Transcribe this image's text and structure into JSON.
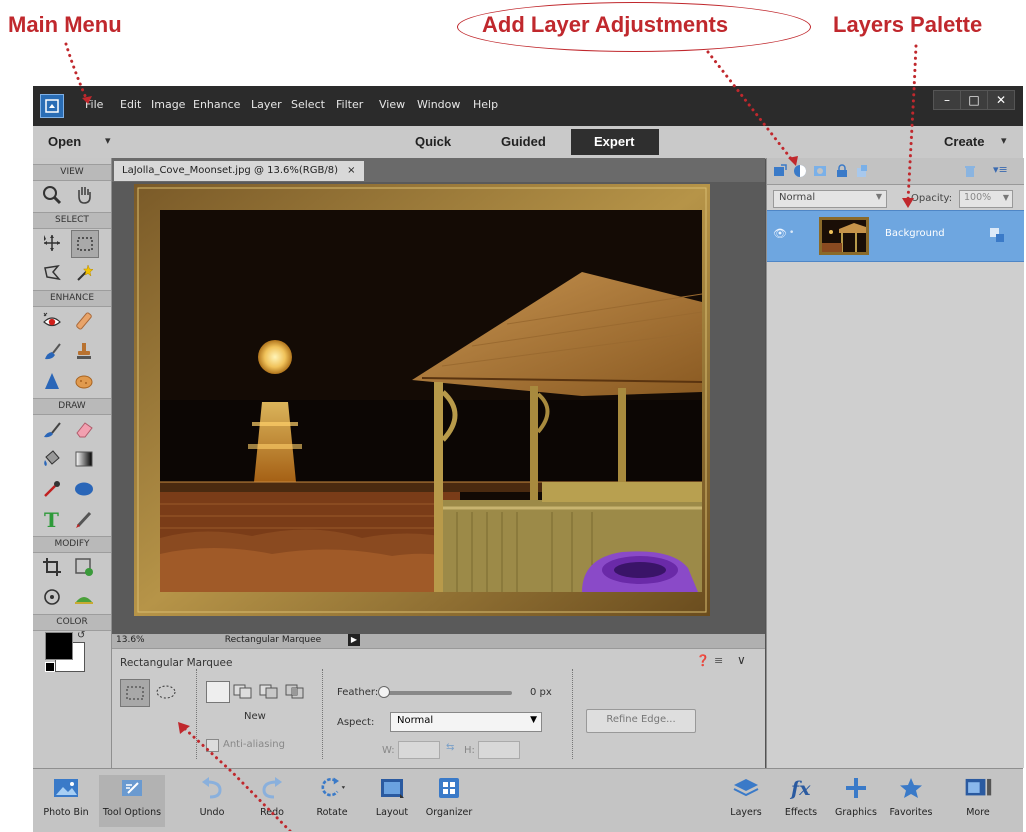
{
  "callouts": {
    "main_menu": "Main  Menu",
    "add_layer_adjustments": "Add Layer Adjustments",
    "layers_palette": "Layers Palette"
  },
  "menu": [
    "File",
    "Edit",
    "Image",
    "Enhance",
    "Layer",
    "Select",
    "Filter",
    "View",
    "Window",
    "Help"
  ],
  "modebar": {
    "open": "Open",
    "quick": "Quick",
    "guided": "Guided",
    "expert": "Expert",
    "create": "Create"
  },
  "tools": {
    "sections": {
      "view": "VIEW",
      "select": "SELECT",
      "enhance": "ENHANCE",
      "draw": "DRAW",
      "modify": "MODIFY",
      "color": "COLOR"
    }
  },
  "document": {
    "tab_title": "LaJolla_Cove_Moonset.jpg @ 13.6%(RGB/8)",
    "tab_close": "×",
    "zoom": "13.6%",
    "status_tool": "Rectangular Marquee"
  },
  "tool_options": {
    "title": "Rectangular Marquee",
    "mode_label": "New",
    "antialiasing": "Anti-aliasing",
    "feather_label": "Feather:",
    "feather_value": "0 px",
    "feather_fraction": 0,
    "aspect_label": "Aspect:",
    "aspect_value": "Normal",
    "w_label": "W:",
    "h_label": "H:",
    "refine_edge": "Refine Edge..."
  },
  "layers": {
    "blend_mode": "Normal",
    "opacity_label": "Opacity:",
    "opacity_value": "100%",
    "layer_name": "Background"
  },
  "bottom_bar": {
    "photo_bin": "Photo Bin",
    "tool_options": "Tool Options",
    "undo": "Undo",
    "redo": "Redo",
    "rotate": "Rotate",
    "layout": "Layout",
    "organizer": "Organizer",
    "layers": "Layers",
    "effects": "Effects",
    "graphics": "Graphics",
    "favorites": "Favorites",
    "more": "More"
  },
  "colors": {
    "callout_red": "#c0282d",
    "active_layer": "#6ea6e0",
    "foreground": "#000000",
    "background": "#ffffff"
  }
}
